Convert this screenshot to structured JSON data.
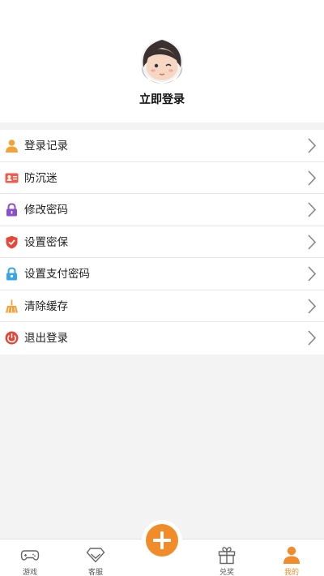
{
  "profile": {
    "login_label": "立即登录",
    "avatar_icon": "cartoon-girl-avatar"
  },
  "menu": {
    "items": [
      {
        "label": "登录记录",
        "icon": "user-icon",
        "color": "#f3a23a"
      },
      {
        "label": "防沉迷",
        "icon": "id-card-icon",
        "color": "#ef5b4c"
      },
      {
        "label": "修改密码",
        "icon": "lock-icon",
        "color": "#8b4fc9"
      },
      {
        "label": "设置密保",
        "icon": "shield-icon",
        "color": "#e8463a"
      },
      {
        "label": "设置支付密码",
        "icon": "lock-icon",
        "color": "#3aa5e6"
      },
      {
        "label": "清除缓存",
        "icon": "broom-icon",
        "color": "#f5a23a"
      },
      {
        "label": "退出登录",
        "icon": "power-icon",
        "color": "#e0483a"
      }
    ]
  },
  "tabbar": {
    "tabs": [
      {
        "label": "游戏",
        "icon": "gamepad-icon",
        "active": false
      },
      {
        "label": "客服",
        "icon": "diamond-icon",
        "active": false
      },
      {
        "label": "兑奖",
        "icon": "gift-icon",
        "active": false
      },
      {
        "label": "我的",
        "icon": "user-icon",
        "active": true
      }
    ],
    "center_button_icon": "plus-icon",
    "accent_color": "#f08c2a"
  }
}
